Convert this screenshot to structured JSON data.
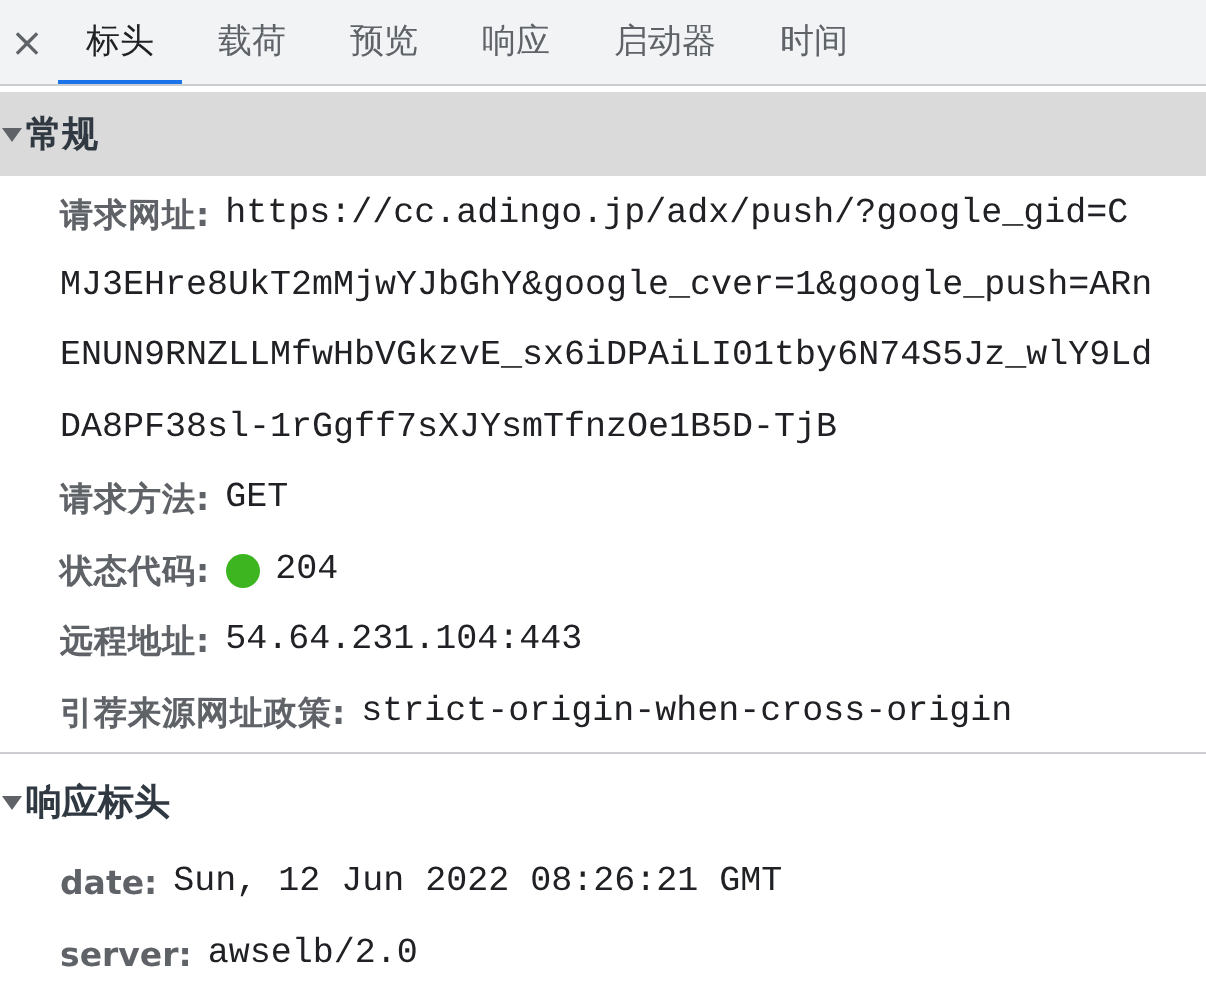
{
  "toolbar": {
    "close_icon": "×"
  },
  "tabs": [
    {
      "label": "标头",
      "selected": true
    },
    {
      "label": "载荷",
      "selected": false
    },
    {
      "label": "预览",
      "selected": false
    },
    {
      "label": "响应",
      "selected": false
    },
    {
      "label": "启动器",
      "selected": false
    },
    {
      "label": "时间",
      "selected": false
    }
  ],
  "sections": [
    {
      "title": "常规",
      "expanded": true,
      "shaded": true,
      "rows": [
        {
          "label": "请求网址:",
          "value_lines": [
            "https://cc.adingo.jp/adx/push/?google_gid=C",
            "MJ3EHre8UkT2mMjwYJbGhY&google_cver=1&google_push=ARn",
            "ENUN9RNZLLMfwHbVGkzvE_sx6iDPAiLI01tby6N74S5Jz_wlY9Ld",
            "DA8PF38sl-1rGgff7sXJYsmTfnzOe1B5D-TjB"
          ]
        },
        {
          "label": "请求方法:",
          "value_lines": [
            "GET"
          ]
        },
        {
          "label": "状态代码:",
          "value_lines": [
            "204"
          ],
          "color": "#3cb521"
        },
        {
          "label": "远程地址:",
          "value_lines": [
            "54.64.231.104:443"
          ]
        },
        {
          "label": "引荐来源网址政策:",
          "value_lines": [
            "strict-origin-when-cross-origin"
          ]
        }
      ]
    },
    {
      "title": "响应标头",
      "expanded": true,
      "shaded": false,
      "rows": [
        {
          "label": "date:",
          "value_lines": [
            "Sun, 12 Jun 2022 08:26:21 GMT"
          ]
        },
        {
          "label": "server:",
          "value_lines": [
            "awselb/2.0"
          ]
        }
      ]
    }
  ]
}
